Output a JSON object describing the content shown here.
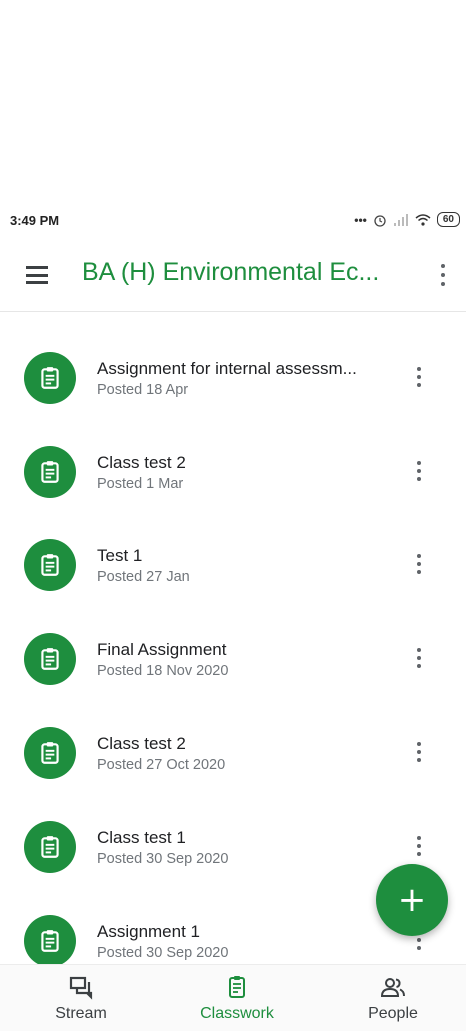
{
  "status": {
    "time": "3:49 PM",
    "battery": "60"
  },
  "app_bar": {
    "title": "BA (H) Environmental Ec..."
  },
  "items": [
    {
      "title": "Assignment for internal assessm...",
      "posted": "Posted 18 Apr"
    },
    {
      "title": "Class test 2",
      "posted": "Posted 1 Mar"
    },
    {
      "title": "Test 1",
      "posted": "Posted 27 Jan"
    },
    {
      "title": "Final Assignment",
      "posted": "Posted 18 Nov 2020"
    },
    {
      "title": "Class test 2",
      "posted": "Posted 27 Oct 2020"
    },
    {
      "title": "Class test 1",
      "posted": "Posted 30 Sep 2020"
    },
    {
      "title": "Assignment 1",
      "posted": "Posted 30 Sep 2020"
    }
  ],
  "fab": {
    "label": "+"
  },
  "bottom_nav": {
    "stream": "Stream",
    "classwork": "Classwork",
    "people": "People"
  },
  "colors": {
    "accent": "#1e8e3e"
  },
  "icons": [
    "menu-icon",
    "more-vert-icon",
    "assignment-icon",
    "add-icon",
    "stream-icon",
    "classwork-icon",
    "people-icon",
    "alarm-icon",
    "signal-icon",
    "wifi-icon"
  ]
}
